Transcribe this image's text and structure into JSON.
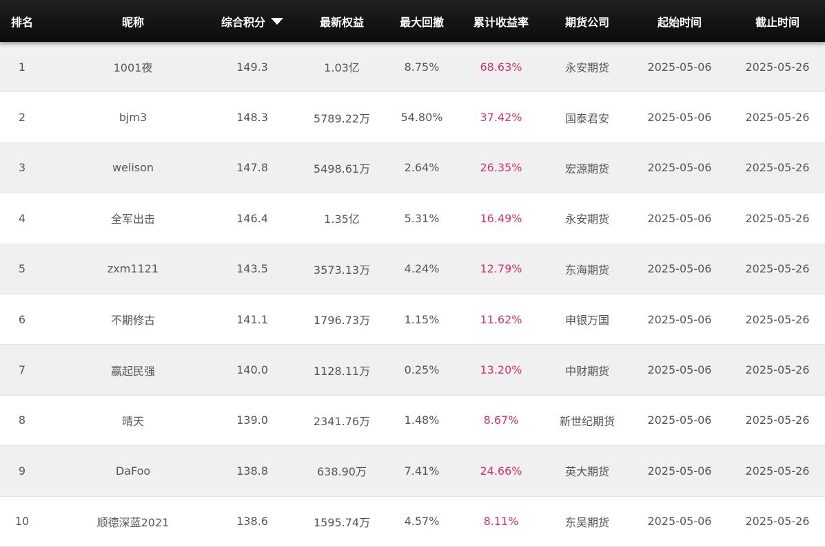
{
  "header": {
    "rank": "排名",
    "nickname": "昵称",
    "score": "综合积分",
    "equity": "最新权益",
    "drawdown": "最大回撤",
    "return": "累计收益率",
    "broker": "期货公司",
    "start": "起始时间",
    "end": "截止时间",
    "sort_icon": "caret-down-icon"
  },
  "colors": {
    "header_bg": "#111111",
    "return_text": "#d6306e",
    "stripe": "#f0f0f0"
  },
  "rows": [
    {
      "rank": "1",
      "nickname": "1001夜",
      "score": "149.3",
      "equity": "1.03亿",
      "drawdown": "8.75%",
      "return": "68.63%",
      "broker": "永安期货",
      "start": "2025-05-06",
      "end": "2025-05-26"
    },
    {
      "rank": "2",
      "nickname": "bjm3",
      "score": "148.3",
      "equity": "5789.22万",
      "drawdown": "54.80%",
      "return": "37.42%",
      "broker": "国泰君安",
      "start": "2025-05-06",
      "end": "2025-05-26"
    },
    {
      "rank": "3",
      "nickname": "welison",
      "score": "147.8",
      "equity": "5498.61万",
      "drawdown": "2.64%",
      "return": "26.35%",
      "broker": "宏源期货",
      "start": "2025-05-06",
      "end": "2025-05-26"
    },
    {
      "rank": "4",
      "nickname": "全军出击",
      "score": "146.4",
      "equity": "1.35亿",
      "drawdown": "5.31%",
      "return": "16.49%",
      "broker": "永安期货",
      "start": "2025-05-06",
      "end": "2025-05-26"
    },
    {
      "rank": "5",
      "nickname": "zxm1121",
      "score": "143.5",
      "equity": "3573.13万",
      "drawdown": "4.24%",
      "return": "12.79%",
      "broker": "东海期货",
      "start": "2025-05-06",
      "end": "2025-05-26"
    },
    {
      "rank": "6",
      "nickname": "不期修古",
      "score": "141.1",
      "equity": "1796.73万",
      "drawdown": "1.15%",
      "return": "11.62%",
      "broker": "申银万国",
      "start": "2025-05-06",
      "end": "2025-05-26"
    },
    {
      "rank": "7",
      "nickname": "赢起民强",
      "score": "140.0",
      "equity": "1128.11万",
      "drawdown": "0.25%",
      "return": "13.20%",
      "broker": "中财期货",
      "start": "2025-05-06",
      "end": "2025-05-26"
    },
    {
      "rank": "8",
      "nickname": "晴天",
      "score": "139.0",
      "equity": "2341.76万",
      "drawdown": "1.48%",
      "return": "8.67%",
      "broker": "新世纪期货",
      "start": "2025-05-06",
      "end": "2025-05-26"
    },
    {
      "rank": "9",
      "nickname": "DaFoo",
      "score": "138.8",
      "equity": "638.90万",
      "drawdown": "7.41%",
      "return": "24.66%",
      "broker": "英大期货",
      "start": "2025-05-06",
      "end": "2025-05-26"
    },
    {
      "rank": "10",
      "nickname": "顺德深蓝2021",
      "score": "138.6",
      "equity": "1595.74万",
      "drawdown": "4.57%",
      "return": "8.11%",
      "broker": "东吴期货",
      "start": "2025-05-06",
      "end": "2025-05-26"
    }
  ]
}
